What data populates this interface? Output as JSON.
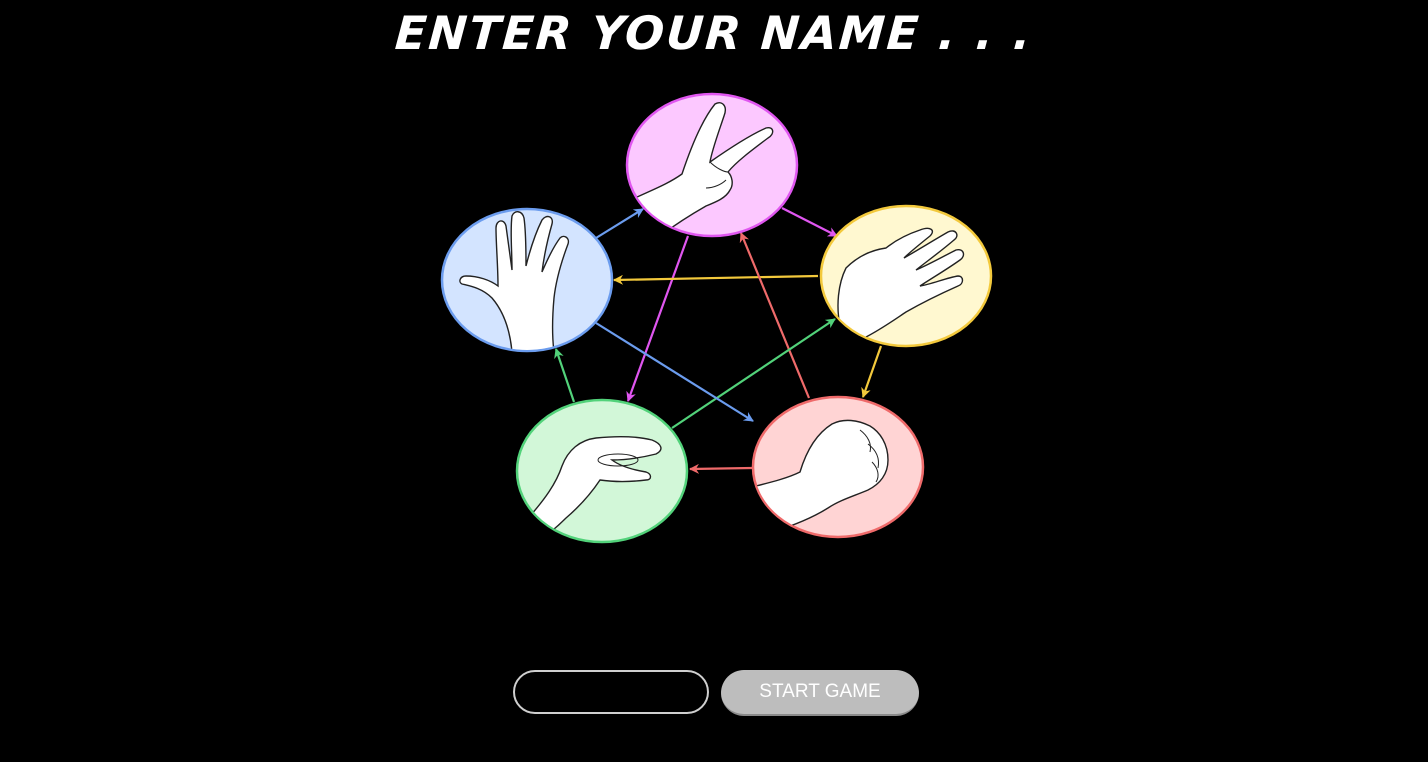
{
  "title": "ENTER YOUR NAME . . .",
  "name_input": {
    "value": "",
    "placeholder": ""
  },
  "start_button_label": "START GAME",
  "gestures": [
    {
      "name": "scissors-gesture",
      "icon": "scissors-hand-icon",
      "fill": "#fcc8ff",
      "stroke": "#e056f0"
    },
    {
      "name": "paper-gesture",
      "icon": "paper-hand-icon",
      "fill": "#fff8d0",
      "stroke": "#f3c93c"
    },
    {
      "name": "rock-gesture",
      "icon": "rock-fist-icon",
      "fill": "#ffd4d4",
      "stroke": "#ef6a6a"
    },
    {
      "name": "lizard-gesture",
      "icon": "lizard-hand-icon",
      "fill": "#d2f7d8",
      "stroke": "#52d27a"
    },
    {
      "name": "spock-gesture",
      "icon": "spock-hand-icon",
      "fill": "#d3e4ff",
      "stroke": "#6b9cee"
    }
  ],
  "colors": {
    "background": "#000000",
    "text": "#ffffff",
    "button": "#bdbdbd",
    "input_border": "#cfcfcf"
  }
}
